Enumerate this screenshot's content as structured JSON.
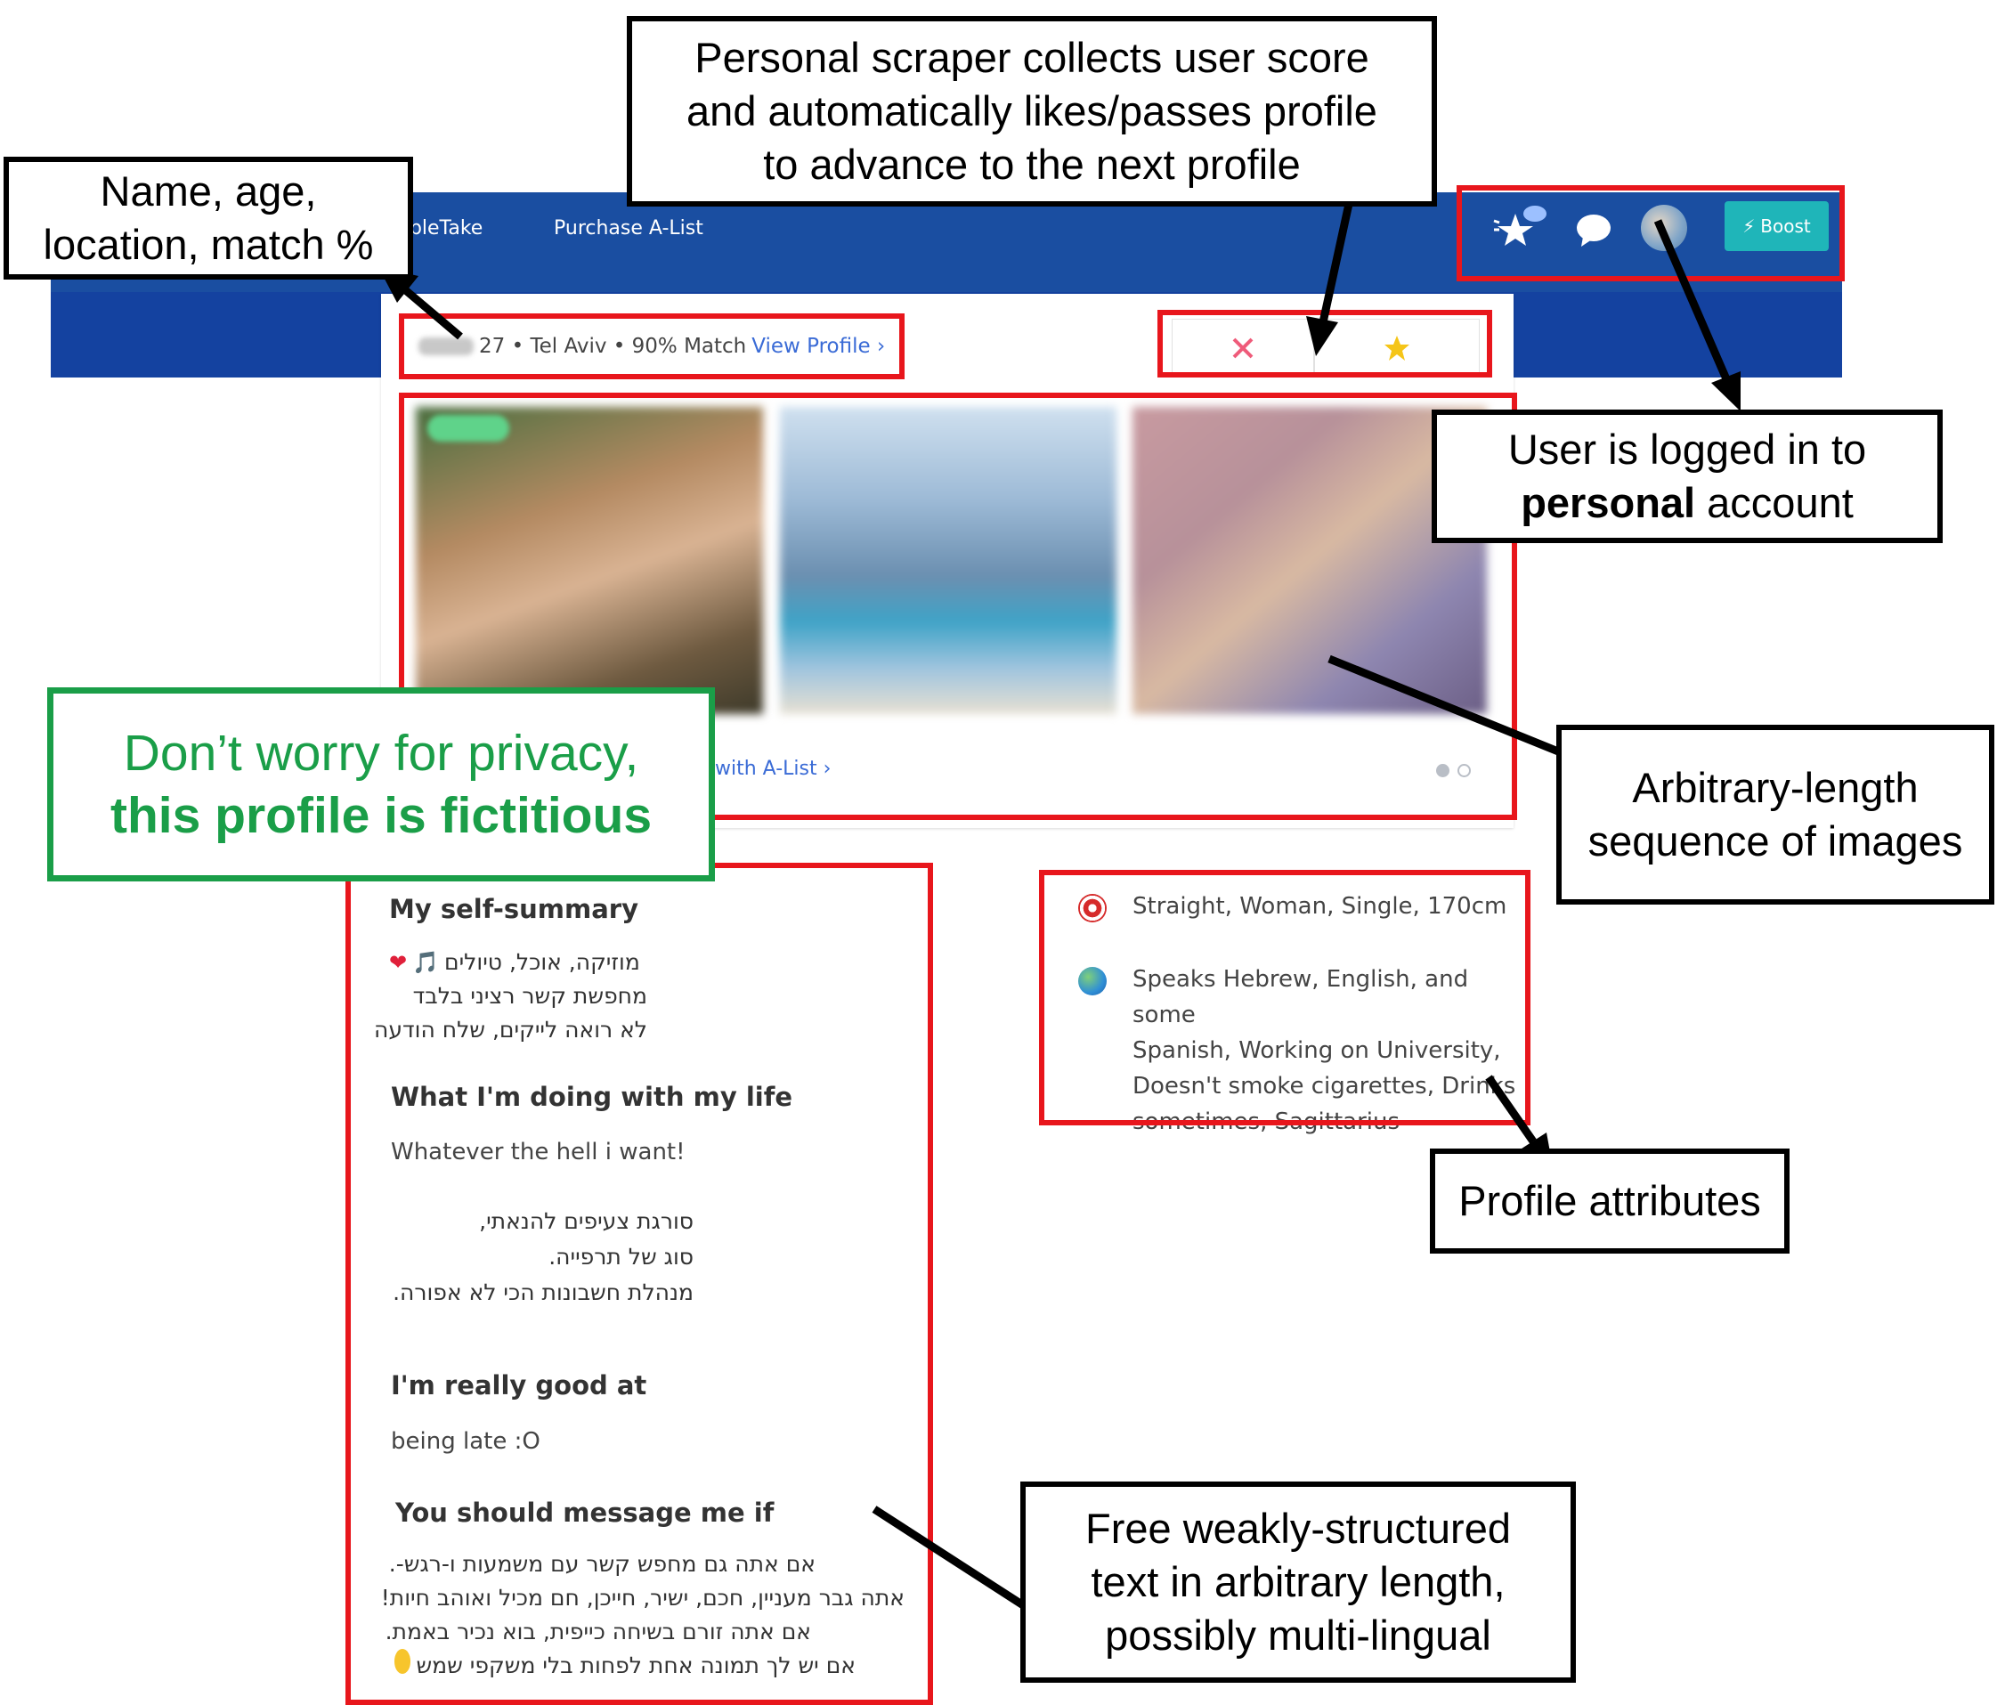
{
  "nav": {
    "link1": "ubleTake",
    "link2": "Purchase A-List",
    "boost_label": "Boost",
    "brand_color": "#1a4ea1"
  },
  "profile_header": {
    "age_location": "27 • Tel Aviv • 90% Match",
    "view_profile": "View Profile"
  },
  "actions": {
    "pass_icon": "x-icon",
    "like_icon": "star-icon"
  },
  "photos": {
    "upsell": "with A-List"
  },
  "essays": {
    "summary_title": "My self-summary",
    "summary_lines": [
      "מוזיקה, אוכל, טיולים",
      "מחפשת קשר רציני בלבד",
      "לא רואה לייקים, שלח הודעה"
    ],
    "life_title": "What I'm doing with my life",
    "life_line1": "Whatever the hell i want!",
    "life_lines_he": [
      "סורגת צעיפים להנאתי,",
      "סוג של תרפייה.",
      "מנהלת חשבונות הכי לא אפורה."
    ],
    "good_title": "I'm really good at",
    "good_text": "being late :O",
    "message_title": "You should message me if",
    "message_lines": [
      "אם אתה גם מחפש קשר עם משמעות ו-רגש-.",
      "אתה גבר מעניין, חכם, ישיר, חייכן, חם מכיל ואוהב חיות!",
      "אם אתה זורם בשיחה כייפית, בוא נכיר באמת.",
      "אם יש לך תמונה אחת לפחות בלי משקפי שמש"
    ]
  },
  "attributes": {
    "line1": "Straight, Woman, Single, 170cm",
    "line2": [
      "Speaks Hebrew, English, and some",
      "Spanish, Working on University,",
      "Doesn't smoke cigarettes, Drinks",
      "sometimes, Sagittarius"
    ]
  },
  "annotations": {
    "name": [
      "Name, age,",
      "location, match %"
    ],
    "scraper": [
      "Personal scraper collects user score",
      "and automatically likes/passes profile",
      "to advance to the next profile"
    ],
    "logged_a": "User is logged in to",
    "logged_b": "personal",
    "logged_c": " account",
    "images": [
      "Arbitrary-length",
      "sequence of images"
    ],
    "privacy_a": "Don’t worry for privacy,",
    "privacy_b": "this profile is fictitious",
    "attrs": "Profile attributes",
    "text": [
      "Free weakly-structured",
      "text in arbitrary length,",
      "possibly multi-lingual"
    ]
  },
  "colors": {
    "red": "#e8161c",
    "green": "#1a9e48",
    "link": "#3a6bd6",
    "teal": "#1fb5b9"
  }
}
